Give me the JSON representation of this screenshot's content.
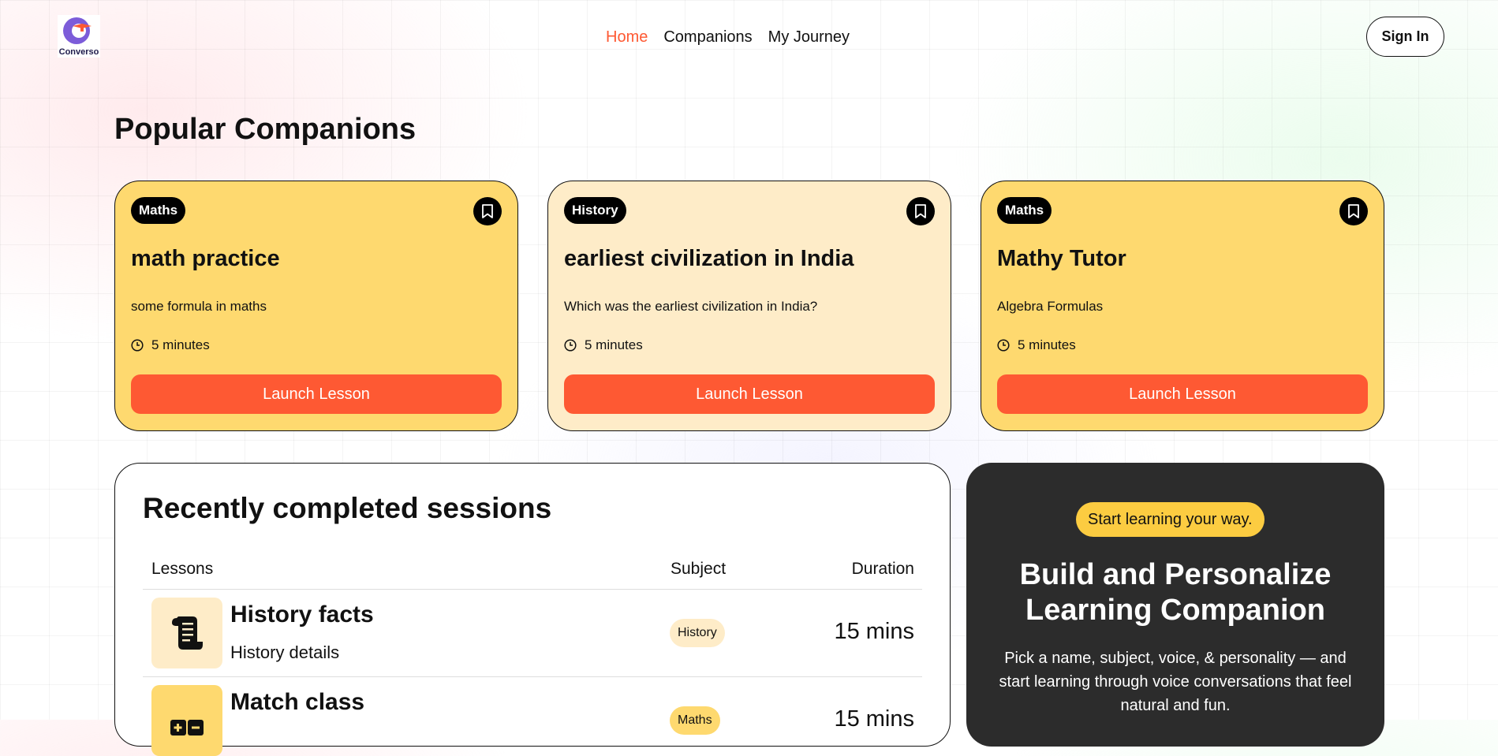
{
  "nav": {
    "logo_text": "Converso",
    "links": [
      {
        "label": "Home",
        "active": true
      },
      {
        "label": "Companions",
        "active": false
      },
      {
        "label": "My Journey",
        "active": false
      }
    ],
    "signin_label": "Sign In"
  },
  "colors": {
    "accent": "#fe5933",
    "maths_bg": "#fed96f",
    "history_bg": "#feecc8",
    "dark_panel": "#2c2c2c",
    "tag_yellow": "#fccc41"
  },
  "popular": {
    "title": "Popular Companions",
    "cards": [
      {
        "subject": "Maths",
        "name": "math practice",
        "topic": "some formula in maths",
        "duration": "5 minutes",
        "button": "Launch Lesson",
        "bg": "#fed96f"
      },
      {
        "subject": "History",
        "name": "earliest civilization in India",
        "topic": "Which was the earliest civilization in India?",
        "duration": "5 minutes",
        "button": "Launch Lesson",
        "bg": "#feecc8"
      },
      {
        "subject": "Maths",
        "name": "Mathy Tutor",
        "topic": "Algebra Formulas",
        "duration": "5 minutes",
        "button": "Launch Lesson",
        "bg": "#fed96f"
      }
    ]
  },
  "sessions": {
    "title": "Recently completed sessions",
    "headers": {
      "lessons": "Lessons",
      "subject": "Subject",
      "duration": "Duration"
    },
    "rows": [
      {
        "title": "History facts",
        "subtitle": "History details",
        "subject": "History",
        "duration": "15 mins",
        "icon": "scroll-icon"
      },
      {
        "title": "Match class",
        "subtitle": "",
        "subject": "Maths",
        "duration": "15 mins",
        "icon": "calculator-icon"
      }
    ]
  },
  "cta": {
    "tag": "Start learning your way.",
    "heading": "Build and Personalize Learning Companion",
    "description": "Pick a name, subject, voice, & personality — and start learning through voice conversations that feel natural and fun."
  }
}
